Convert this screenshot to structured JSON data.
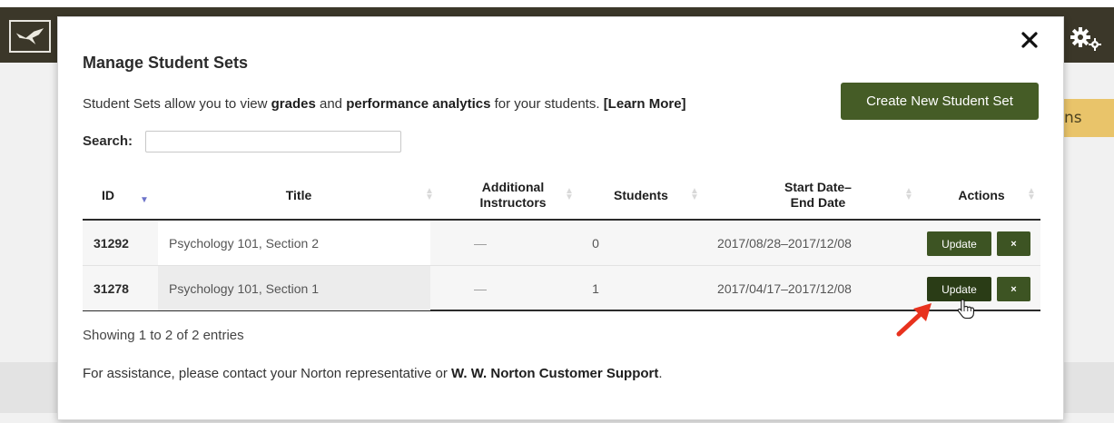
{
  "app": {
    "logo_icon": "bird-logo-icon",
    "settings_icon": "gears-icon",
    "partial_button_text": "ns"
  },
  "modal": {
    "title": "Manage Student Sets",
    "intro": {
      "part1": "Student Sets allow you to view ",
      "grades": "grades",
      "part2": " and ",
      "analytics": "performance analytics",
      "part3": " for your students. ",
      "learn_more": "[Learn More]"
    },
    "create_button": "Create New Student Set",
    "search": {
      "label": "Search:",
      "value": "",
      "placeholder": ""
    },
    "table": {
      "headers": {
        "id": "ID",
        "title": "Title",
        "instructors_line1": "Additional",
        "instructors_line2": "Instructors",
        "students": "Students",
        "dates_line1": "Start Date–",
        "dates_line2": "End Date",
        "actions": "Actions"
      },
      "rows": [
        {
          "id": "31292",
          "title": "Psychology 101, Section 2",
          "instructors": "—",
          "students": "0",
          "dates": "2017/08/28–2017/12/08",
          "update": "Update",
          "delete": "×"
        },
        {
          "id": "31278",
          "title": "Psychology 101, Section 1",
          "instructors": "—",
          "students": "1",
          "dates": "2017/04/17–2017/12/08",
          "update": "Update",
          "delete": "×"
        }
      ]
    },
    "showing": "Showing 1 to 2 of 2 entries",
    "assistance": {
      "text": "For assistance, please contact your Norton representative or ",
      "link": "W. W. Norton Customer Support",
      "end": "."
    }
  },
  "colors": {
    "topbar": "#3b3729",
    "primary_button": "#455c26",
    "annotation_arrow": "#e8321e",
    "accent_yellow": "#e9c46a"
  }
}
